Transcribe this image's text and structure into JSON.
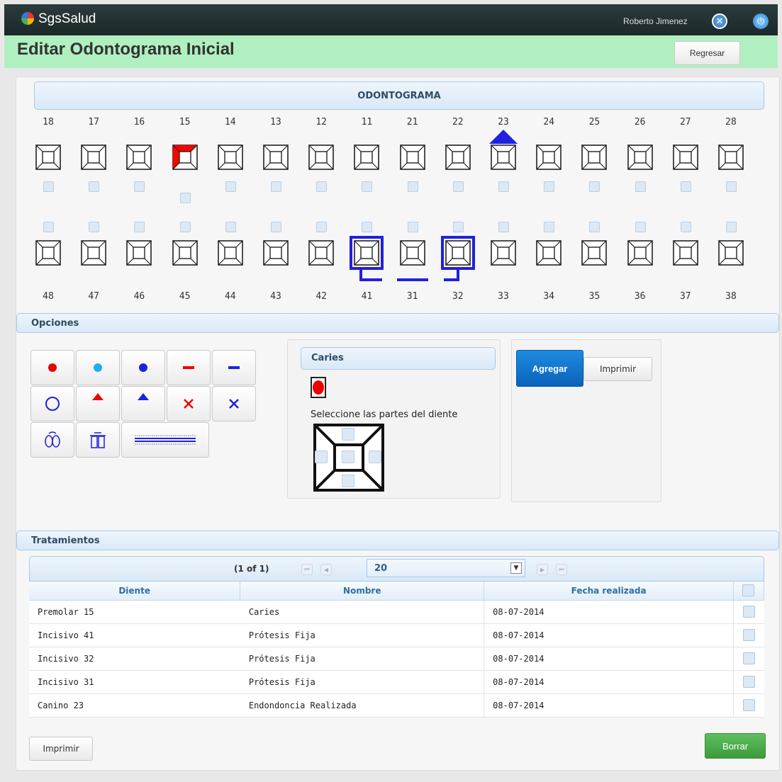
{
  "app": {
    "brand": "SgsSalud",
    "username": "Roberto Jimenez"
  },
  "page": {
    "title": "Editar Odontograma Inicial",
    "back_label": "Regresar"
  },
  "odontograma": {
    "header": "ODONTOGRAMA",
    "upper_teeth": [
      "18",
      "17",
      "16",
      "15",
      "14",
      "13",
      "12",
      "11",
      "21",
      "22",
      "23",
      "24",
      "25",
      "26",
      "27",
      "28"
    ],
    "lower_teeth": [
      "48",
      "47",
      "46",
      "45",
      "44",
      "43",
      "42",
      "41",
      "31",
      "32",
      "33",
      "34",
      "35",
      "36",
      "37",
      "38"
    ],
    "marked": {
      "caries_tooth": "15",
      "endodoncia_tooth": "23",
      "protesis_teeth": [
        "41",
        "31",
        "32"
      ],
      "caries_color": "#ff0000",
      "treatment_color": "#2020dd"
    }
  },
  "opciones": {
    "header": "Opciones",
    "caries_title": "Caries",
    "select_parts_label": "Seleccione las partes del diente",
    "add_label": "Agregar",
    "print_label": "Imprimir"
  },
  "tratamientos": {
    "header": "Tratamientos",
    "page_info": "(1 of 1)",
    "rows_per_page": "20",
    "columns": [
      "Diente",
      "Nombre",
      "Fecha realizada"
    ],
    "rows": [
      {
        "diente": "Premolar  15",
        "nombre": "Caries",
        "fecha": "08-07-2014"
      },
      {
        "diente": "Incisivo  41",
        "nombre": "Prótesis Fija",
        "fecha": "08-07-2014"
      },
      {
        "diente": "Incisivo  32",
        "nombre": "Prótesis Fija",
        "fecha": "08-07-2014"
      },
      {
        "diente": "Incisivo  31",
        "nombre": "Prótesis Fija",
        "fecha": "08-07-2014"
      },
      {
        "diente": "Canino  23",
        "nombre": "Endondoncia Realizada",
        "fecha": "08-07-2014"
      }
    ],
    "print_label": "Imprimir",
    "delete_label": "Borrar"
  }
}
